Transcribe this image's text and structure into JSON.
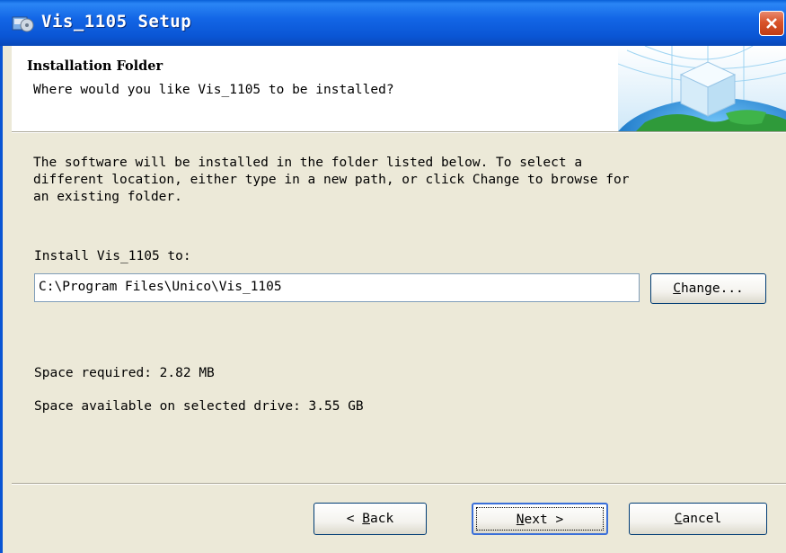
{
  "window": {
    "title": "Vis_1105 Setup"
  },
  "header": {
    "title": "Installation Folder",
    "subtitle": "Where would you like Vis_1105 to be installed?"
  },
  "body": {
    "intro": "The software will be installed in the folder listed below. To select a\ndifferent location, either type in a new path, or click Change to browse for\nan existing folder.",
    "install_label": "Install Vis_1105 to:",
    "install_path": "C:\\Program Files\\Unico\\Vis_1105",
    "change_label_pre": "",
    "change_label_key": "C",
    "change_label_rest": "hange...",
    "space_required": "Space required: 2.82 MB",
    "space_available": "Space available on selected drive: 3.55 GB"
  },
  "buttons": {
    "back_prefix": "< ",
    "back_key": "B",
    "back_rest": "ack",
    "next_key": "N",
    "next_rest": "ext >",
    "cancel_key": "C",
    "cancel_rest": "ancel"
  },
  "icons": {
    "title_icon": "setup-disk-icon",
    "close": "close-icon",
    "header_graphic": "globe-cube-graphic"
  },
  "colors": {
    "titlebar": "#0a55d4",
    "dialog_bg": "#ece9d8",
    "close_button": "#d9542a"
  }
}
